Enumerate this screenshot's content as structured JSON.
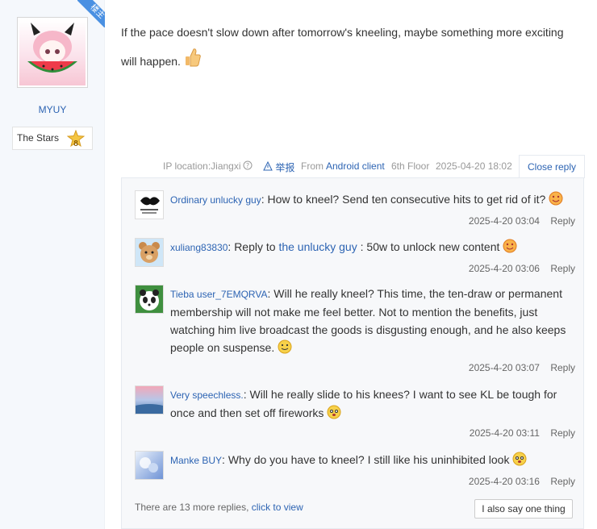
{
  "user": {
    "name": "MYUY",
    "badge_ribbon": "楼主",
    "level_title": "The Stars",
    "level_number": "8"
  },
  "post": {
    "text": "If the pace doesn't slow down after tomorrow's kneeling, maybe something more exciting will happen."
  },
  "meta": {
    "ip_location": "IP location:Jiangxi",
    "report": "举报",
    "from_prefix": "From",
    "client": "Android client",
    "floor": "6th Floor",
    "time": "2025-04-20 18:02",
    "close_reply": "Close reply"
  },
  "replies": [
    {
      "user": "Ordinary unlucky guy",
      "text": "How to kneel? Send ten consecutive hits to get rid of it?",
      "time": "2025-4-20 03:04",
      "reply": "Reply"
    },
    {
      "user": "xuliang83830",
      "prefix": "Reply to",
      "target": "the unlucky guy",
      "text": ": 50w to unlock new content",
      "time": "2025-4-20 03:06",
      "reply": "Reply"
    },
    {
      "user": "Tieba user_7EMQRVA",
      "text": "Will he really kneel? This time, the ten-draw or permanent membership will not make me feel better. Not to mention the benefits, just watching him live broadcast the goods is disgusting enough, and he also keeps people on suspense.",
      "time": "2025-4-20 03:07",
      "reply": "Reply"
    },
    {
      "user": "Very speechless.",
      "text": "Will he really slide to his knees? I want to see KL be tough for once and then set off fireworks",
      "time": "2025-4-20 03:11",
      "reply": "Reply"
    },
    {
      "user": "Manke BUY",
      "text": "Why do you have to kneel? I still like his uninhibited look",
      "time": "2025-4-20 03:16",
      "reply": "Reply"
    }
  ],
  "footer": {
    "more_text": "There are 13 more replies,",
    "more_link": "click to view",
    "say_button": "I also say one thing"
  },
  "colors": {
    "link": "#2d64b3",
    "left_bg": "#f5f8fc",
    "reply_bg": "#f7f8fa",
    "ribbon": "#4a90e2"
  }
}
